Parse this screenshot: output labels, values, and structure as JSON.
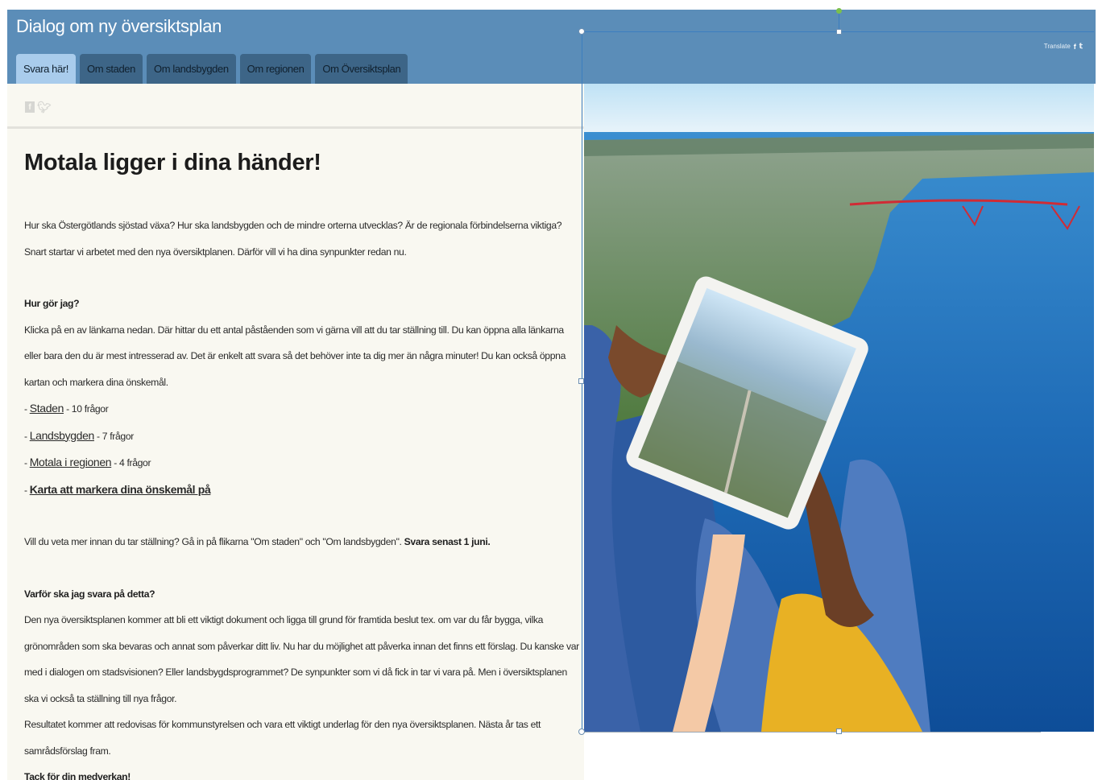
{
  "site": {
    "title": "Dialog om ny översiktsplan",
    "translate_label": "Translate",
    "tabs": [
      {
        "label": "Svara här!",
        "active": true
      },
      {
        "label": "Om staden",
        "active": false
      },
      {
        "label": "Om landsbygden",
        "active": false
      },
      {
        "label": "Om regionen",
        "active": false
      },
      {
        "label": "Om Översiktsplan",
        "active": false
      }
    ]
  },
  "icons": {
    "facebook": "facebook-icon",
    "twitter": "twitter-icon"
  },
  "colors": {
    "header": "#5b8db8",
    "tab": "#3d6587",
    "tab_active": "#a9ccec",
    "content_bg": "#f9f8f1"
  },
  "article": {
    "heading": "Motala ligger i dina händer!",
    "intro": "Hur ska Östergötlands sjöstad växa? Hur ska landsbygden och de mindre orterna utvecklas? Är de regionala förbindelserna viktiga? Snart startar vi arbetet med den nya översiktplanen. Därför vill vi ha dina synpunkter redan nu.",
    "how_heading": "Hur gör jag?",
    "how_text": "Klicka på en av länkarna nedan. Där hittar du ett antal påståenden som vi gärna vill att du tar ställning till. Du kan öppna alla länkarna eller bara den du är mest intresserad av. Det är enkelt att svara så det behöver inte ta dig mer än några minuter! Du kan också öppna kartan och markera dina önskemål.",
    "links": [
      {
        "prefix": "- ",
        "label": "Staden",
        "suffix": " - 10 frågor",
        "bold": false
      },
      {
        "prefix": "- ",
        "label": "Landsbygden",
        "suffix": " - 7 frågor",
        "bold": false
      },
      {
        "prefix": "- ",
        "label": "Motala i regionen",
        "suffix": " - 4 frågor",
        "bold": false
      },
      {
        "prefix": "- ",
        "label": "Karta att markera dina önskemål på",
        "suffix": "",
        "bold": true
      }
    ],
    "more_text": "Vill du veta mer innan du tar ställning? Gå in på flikarna \"Om staden\" och \"Om landsbygden\".",
    "deadline": "Svara senast 1 juni.",
    "why_heading": "Varför ska jag svara på detta?",
    "why_text": "Den nya översiktsplanen kommer att bli ett viktigt dokument och ligga till grund för framtida beslut tex. om var du får bygga, vilka grönområden som ska bevaras och annat som påverkar ditt liv. Nu har du möjlighet att påverka innan det finns ett förslag. Du kanske var med i dialogen om stadsvisionen? Eller landsbygdsprogrammet? De synpunkter som vi då fick in tar vi vara på. Men i översiktsplanen ska vi också ta ställning till nya frågor.",
    "result_text": "Resultatet kommer att redovisas för kommunstyrelsen och vara ett viktigt underlag för den nya översiktsplanen. Nästa år tas ett samrådsförslag fram.",
    "thanks": "Tack för din medverkan!"
  }
}
